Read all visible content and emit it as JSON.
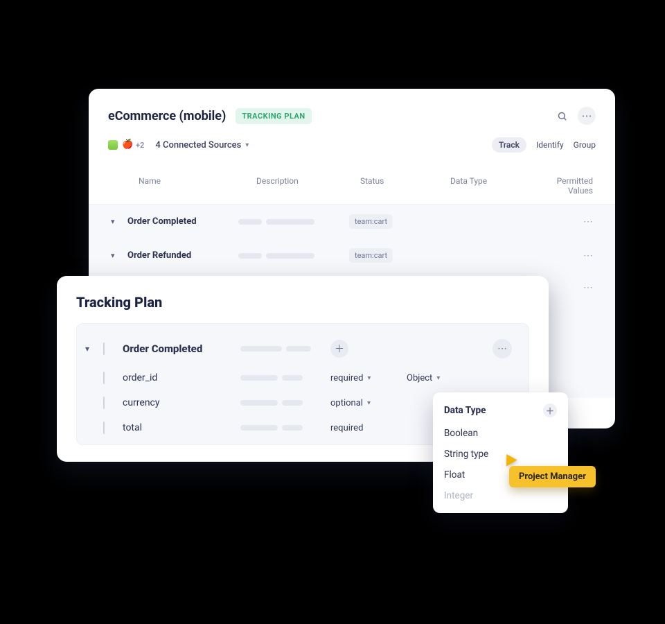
{
  "back": {
    "title": "eCommerce (mobile)",
    "badge": "TRACKING PLAN",
    "sources_count_more": "+2",
    "sources_label": "4 Connected Sources",
    "tabs": {
      "track": "Track",
      "identify": "Identify",
      "group": "Group"
    },
    "cols": {
      "name": "Name",
      "description": "Description",
      "status": "Status",
      "data_type": "Data Type",
      "permitted": "Permitted Values"
    },
    "rows": [
      {
        "name": "Order Completed",
        "status": "team:cart"
      },
      {
        "name": "Order Refunded",
        "status": "team:cart"
      }
    ]
  },
  "front": {
    "title": "Tracking Plan",
    "event": "Order Completed",
    "props": [
      {
        "name": "order_id",
        "status": "required",
        "type": "Object"
      },
      {
        "name": "currency",
        "status": "optional",
        "type": ""
      },
      {
        "name": "total",
        "status": "required",
        "type": ""
      }
    ]
  },
  "dropdown": {
    "title": "Data Type",
    "items": [
      "Boolean",
      "String type",
      "Float",
      "Integer"
    ]
  },
  "cursor_label": "Project Manager"
}
